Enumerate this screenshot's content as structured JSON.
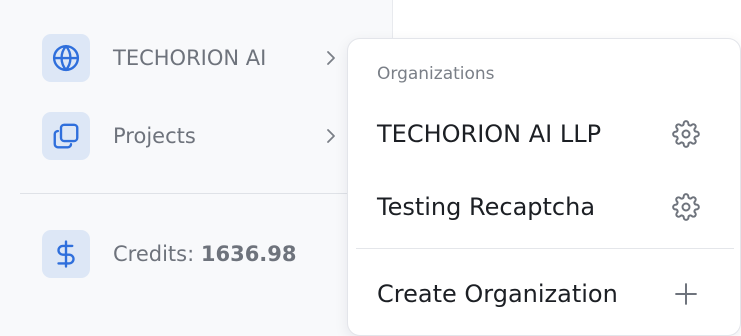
{
  "sidebar": {
    "org_item": {
      "label": "TECHORION AI",
      "icon": "globe-icon"
    },
    "projects_item": {
      "label": "Projects",
      "icon": "folders-icon"
    },
    "credits_item": {
      "label_prefix": "Credits:",
      "value": "1636.98",
      "icon": "dollar-icon"
    }
  },
  "dropdown": {
    "heading": "Organizations",
    "organizations": [
      {
        "name": "TECHORION AI LLP",
        "icon": "gear-icon"
      },
      {
        "name": "Testing Recaptcha",
        "icon": "gear-icon"
      }
    ],
    "create_label": "Create Organization",
    "create_icon": "plus-icon"
  },
  "colors": {
    "icon_blue": "#2f6fdc",
    "icon_bg": "#dde7f6",
    "sidebar_bg": "#f8f9fb"
  }
}
